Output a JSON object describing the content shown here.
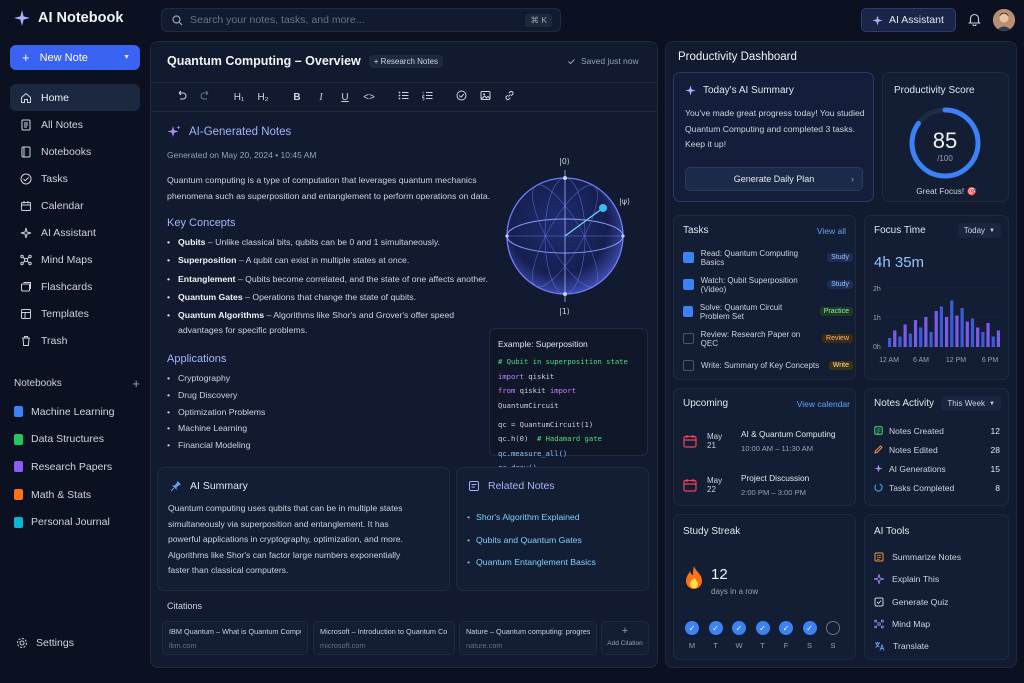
{
  "app": {
    "name": "AI Notebook"
  },
  "sidebar": {
    "new_note": "New Note",
    "nav": [
      {
        "label": "Home",
        "icon": "home-icon"
      },
      {
        "label": "All Notes",
        "icon": "notes-icon"
      },
      {
        "label": "Notebooks",
        "icon": "notebook-icon"
      },
      {
        "label": "Tasks",
        "icon": "check-circle-icon"
      },
      {
        "label": "Calendar",
        "icon": "calendar-icon"
      },
      {
        "label": "AI Assistant",
        "icon": "sparkle-icon"
      },
      {
        "label": "Mind Maps",
        "icon": "mindmap-icon"
      },
      {
        "label": "Flashcards",
        "icon": "flashcard-icon"
      },
      {
        "label": "Templates",
        "icon": "template-icon"
      },
      {
        "label": "Trash",
        "icon": "trash-icon"
      }
    ],
    "notebooks_heading": "Notebooks",
    "notebooks": [
      {
        "label": "Machine Learning",
        "color": "#3b82f6"
      },
      {
        "label": "Data Structures",
        "color": "#22c55e"
      },
      {
        "label": "Research Papers",
        "color": "#8b5cf6"
      },
      {
        "label": "Math & Stats",
        "color": "#f97316"
      },
      {
        "label": "Personal Journal",
        "color": "#06b6d4"
      }
    ],
    "settings": "Settings"
  },
  "topbar": {
    "search_placeholder": "Search your notes, tasks, and more...",
    "search_shortcut": "⌘ K",
    "ai_assistant": "AI Assistant"
  },
  "editor": {
    "title": "Quantum Computing – Overview",
    "tag": "+ Research Notes",
    "saved": "Saved just now",
    "toolbar": {
      "h1": "H₁",
      "h2": "H₂",
      "bold": "B",
      "italic": "I",
      "underline": "U",
      "code": "<>"
    },
    "ai_heading": "AI-Generated Notes",
    "generated_on": "Generated on May 20, 2024 • 10:45 AM",
    "intro": "Quantum computing is a type of computation that leverages quantum mechanics phenomena such as superposition and entanglement to perform operations on data.",
    "key_concepts_heading": "Key Concepts",
    "key_concepts": [
      {
        "term": "Qubits",
        "desc": " – Unlike classical bits, qubits can be 0 and 1 simultaneously."
      },
      {
        "term": "Superposition",
        "desc": " – A qubit can exist in multiple states at once."
      },
      {
        "term": "Entanglement",
        "desc": " – Qubits become correlated, and the state of one affects another."
      },
      {
        "term": "Quantum Gates",
        "desc": " – Operations that change the state of qubits."
      },
      {
        "term": "Quantum Algorithms",
        "desc": " – Algorithms like Shor's and Grover's offer speed advantages for specific problems."
      }
    ],
    "applications_heading": "Applications",
    "applications": [
      "Cryptography",
      "Drug Discovery",
      "Optimization Problems",
      "Machine Learning",
      "Financial Modeling"
    ],
    "bloch": {
      "top": "|0⟩",
      "bottom": "|1⟩",
      "psi": "|ψ⟩"
    },
    "code_example": {
      "title": "Example: Superposition",
      "comment1": "# Qubit in superposition state",
      "import_kw": "import",
      "import_mod": " qiskit",
      "from_kw": "from",
      "from_mod": " qiskit ",
      "from_import": "import",
      "from_name": " QuantumCircuit",
      "qc_assign": "qc = QuantumCircuit(1)",
      "h_gate": "qc.h(0)",
      "h_comment": "# Hadamard gate",
      "measure": "qc.measure_all()",
      "draw": "qc.draw()"
    },
    "ai_summary": {
      "heading": "AI Summary",
      "text": "Quantum computing uses qubits that can be in multiple states simultaneously via superposition and entanglement. It has powerful applications in cryptography, optimization, and more. Algorithms like Shor's can factor large numbers exponentially faster than classical computers."
    },
    "related": {
      "heading": "Related Notes",
      "items": [
        "Shor's Algorithm Explained",
        "Qubits and Quantum Gates",
        "Quantum Entanglement Basics"
      ]
    },
    "citations": {
      "heading": "Citations",
      "items": [
        {
          "title": "IBM Quantum – What is Quantum Comput...",
          "url": "ibm.com"
        },
        {
          "title": "Microsoft – Introduction to Quantum Co...",
          "url": "microsoft.com"
        },
        {
          "title": "Nature – Quantum computing: progress...",
          "url": "nature.com"
        }
      ],
      "add": "Add Citation"
    }
  },
  "dashboard": {
    "title": "Productivity Dashboard",
    "summary": {
      "heading": "Today's AI Summary",
      "text": "You've made great progress today! You studied Quantum Computing and completed 3 tasks. Keep it up!",
      "button": "Generate Daily Plan"
    },
    "score": {
      "heading": "Productivity Score",
      "value": "85",
      "max": "/100",
      "fraction": 0.85,
      "caption": "Great Focus! 🎯"
    },
    "tasks": {
      "heading": "Tasks",
      "view_all": "View all",
      "items": [
        {
          "label": "Read: Quantum Computing Basics",
          "tag": "Study",
          "done": true
        },
        {
          "label": "Watch: Qubit Superposition (Video)",
          "tag": "Study",
          "done": true
        },
        {
          "label": "Solve: Quantum Circuit Problem Set",
          "tag": "Practice",
          "done": true
        },
        {
          "label": "Review: Research Paper on QEC",
          "tag": "Review",
          "done": false
        },
        {
          "label": "Write: Summary of Key Concepts",
          "tag": "Write",
          "done": false
        }
      ]
    },
    "focus": {
      "heading": "Focus Time",
      "period": "Today",
      "total": "4h 35m",
      "y_ticks": [
        "2h",
        "1h",
        "0h"
      ],
      "x_ticks": [
        "12 AM",
        "6 AM",
        "12 PM",
        "6 PM"
      ]
    },
    "upcoming": {
      "heading": "Upcoming",
      "view_calendar": "View calendar",
      "events": [
        {
          "date": "May 21",
          "title": "AI & Quantum Computing",
          "time": "10:00 AM – 11:30 AM"
        },
        {
          "date": "May 22",
          "title": "Project Discussion",
          "time": "2:00 PM – 3:00 PM"
        }
      ]
    },
    "activity": {
      "heading": "Notes Activity",
      "period": "This Week",
      "items": [
        {
          "label": "Notes Created",
          "value": "12"
        },
        {
          "label": "Notes Edited",
          "value": "28"
        },
        {
          "label": "AI Generations",
          "value": "15"
        },
        {
          "label": "Tasks Completed",
          "value": "8"
        }
      ]
    },
    "streak": {
      "heading": "Study Streak",
      "days": "12",
      "caption": "days in a row",
      "week": [
        "M",
        "T",
        "W",
        "T",
        "F",
        "S",
        "S"
      ]
    },
    "ai_tools": {
      "heading": "AI Tools",
      "items": [
        "Summarize Notes",
        "Explain This",
        "Generate Quiz",
        "Mind Map",
        "Translate"
      ]
    }
  },
  "chart_data": {
    "type": "bar",
    "ylim": [
      0,
      2
    ],
    "y_unit": "hours",
    "values": [
      0.3,
      0.55,
      0.35,
      0.75,
      0.45,
      0.9,
      0.65,
      1.0,
      0.5,
      1.2,
      1.35,
      1.0,
      1.55,
      1.05,
      1.3,
      0.85,
      0.95,
      0.65,
      0.5,
      0.8,
      0.35,
      0.55
    ],
    "x_ticks": [
      "12 AM",
      "6 AM",
      "12 PM",
      "6 PM"
    ]
  }
}
